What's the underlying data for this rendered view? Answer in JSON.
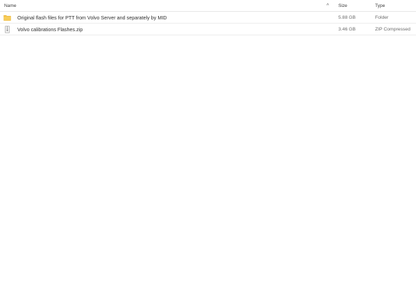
{
  "header": {
    "name_label": "Name",
    "sort_icon": "chevron-up-icon",
    "sort_glyph": "^",
    "size_label": "Size",
    "type_label": "Type"
  },
  "rows": [
    {
      "icon": "folder-icon",
      "name": "Original flash files for PTT from Volvo Server and separately by MID",
      "size": "5.88 GB",
      "type": "Folder"
    },
    {
      "icon": "zip-file-icon",
      "name": "Volvo calibrations Flashes.zip",
      "size": "3.46 GB",
      "type": "ZIP Compressed"
    }
  ],
  "colors": {
    "folder": "#f5c242",
    "zip": "#9a9a9a"
  }
}
